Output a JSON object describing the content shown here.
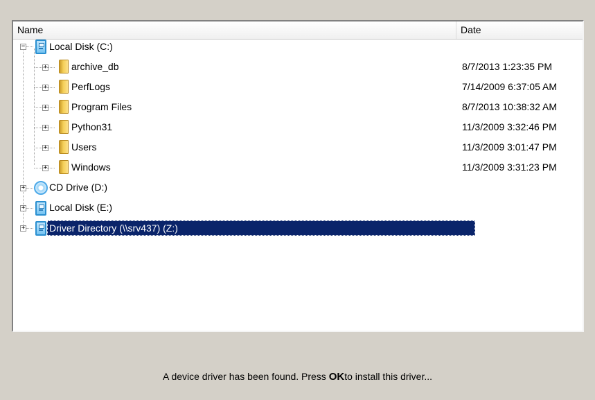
{
  "columns": {
    "name": "Name",
    "date": "Date"
  },
  "tree": {
    "c_drive": {
      "label": "Local Disk (C:)",
      "icon": "disk-icon",
      "expanded": true
    },
    "folders": [
      {
        "label": "archive_db",
        "date": "8/7/2013 1:23:35 PM",
        "icon": "folder-icon"
      },
      {
        "label": "PerfLogs",
        "date": "7/14/2009 6:37:05 AM",
        "icon": "folder-icon"
      },
      {
        "label": "Program Files",
        "date": "8/7/2013 10:38:32 AM",
        "icon": "folder-icon"
      },
      {
        "label": "Python31",
        "date": "11/3/2009 3:32:46 PM",
        "icon": "folder-icon"
      },
      {
        "label": "Users",
        "date": "11/3/2009 3:01:47 PM",
        "icon": "folder-icon"
      },
      {
        "label": "Windows",
        "date": "11/3/2009 3:31:23 PM",
        "icon": "folder-icon"
      }
    ],
    "d_drive": {
      "label": "CD Drive (D:)",
      "icon": "cd-icon"
    },
    "e_drive": {
      "label": "Local Disk (E:)",
      "icon": "disk-icon"
    },
    "z_drive": {
      "label": "Driver Directory (\\\\srv437) (Z:)",
      "icon": "disk-icon",
      "selected": true
    }
  },
  "status": {
    "prefix": "A device driver has been found. Press ",
    "bold": "OK",
    "suffix": "to install this driver..."
  },
  "colors": {
    "selection": "#0a246a",
    "dialog_bg": "#d4d0c8"
  }
}
